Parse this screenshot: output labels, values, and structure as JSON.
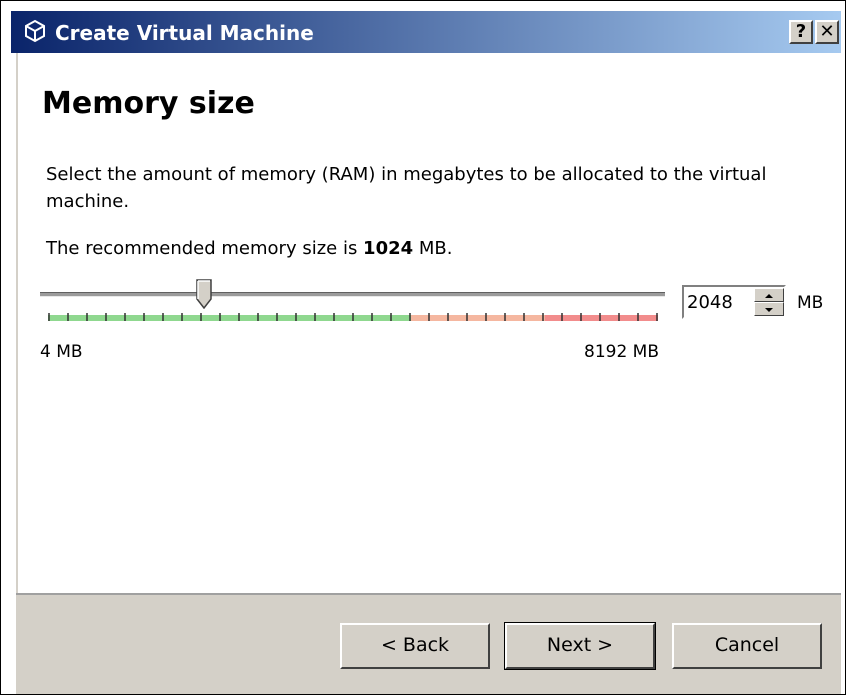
{
  "window": {
    "title": "Create Virtual Machine",
    "help_label": "?",
    "close_label": "✕"
  },
  "page": {
    "title": "Memory size",
    "description": "Select the amount of memory (RAM) in megabytes to be allocated to the virtual machine.",
    "recommend_prefix": "The recommended memory size is ",
    "recommend_value": "1024",
    "recommend_suffix": " MB."
  },
  "slider": {
    "min_label": "4 MB",
    "max_label": "8192 MB",
    "value": 2048,
    "min": 4,
    "max": 8192
  },
  "spinbox": {
    "value": "2048",
    "unit": "MB"
  },
  "buttons": {
    "back": "< Back",
    "next": "Next >",
    "cancel": "Cancel"
  },
  "colors": {
    "title_start": "#0a246a",
    "title_end": "#a6caf0",
    "tick_ok": "#8fd88f",
    "tick_warn": "#f5b7a0",
    "tick_bad": "#f28c8c"
  }
}
